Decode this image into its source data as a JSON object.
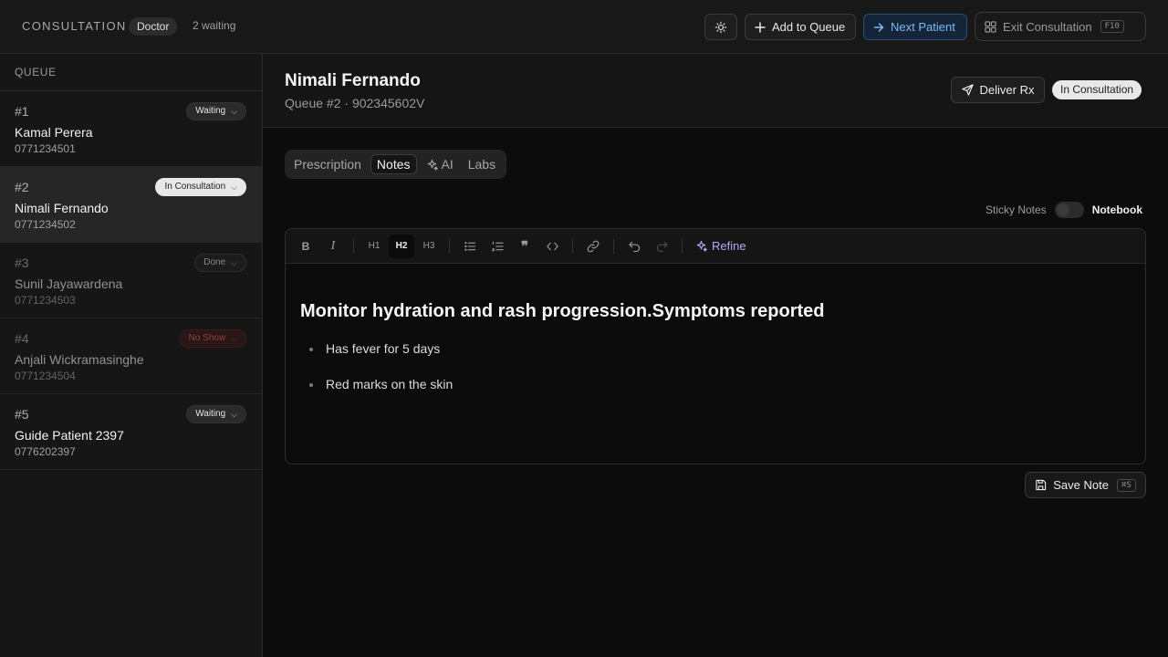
{
  "header": {
    "brand": "CONSULTATION",
    "role": "Doctor",
    "waiting": "2 waiting",
    "add_to_queue": "Add to Queue",
    "next_patient": "Next Patient",
    "exit_consultation": "Exit Consultation",
    "exit_shortcut": "F10"
  },
  "queue": {
    "title": "QUEUE",
    "items": [
      {
        "number": "#1",
        "name": "Kamal Perera",
        "phone": "0771234501",
        "status": "Waiting"
      },
      {
        "number": "#2",
        "name": "Nimali Fernando",
        "phone": "0771234502",
        "status": "In Consultation"
      },
      {
        "number": "#3",
        "name": "Sunil Jayawardena",
        "phone": "0771234503",
        "status": "Done"
      },
      {
        "number": "#4",
        "name": "Anjali Wickramasinghe",
        "phone": "0771234504",
        "status": "No Show"
      },
      {
        "number": "#5",
        "name": "Guide Patient 2397",
        "phone": "0776202397",
        "status": "Waiting"
      }
    ]
  },
  "patient": {
    "name": "Nimali Fernando",
    "meta": "Queue #2 · 902345602V",
    "deliver_rx": "Deliver Rx",
    "status": "In Consultation"
  },
  "tabs": [
    "Prescription",
    "Notes",
    "AI",
    "Labs"
  ],
  "active_tab": "Notes",
  "notes_mode": {
    "left": "Sticky Notes",
    "right": "Notebook",
    "selected": "Notebook"
  },
  "editor": {
    "toolbar": {
      "h1": "H1",
      "h2": "H2",
      "h3": "H3",
      "refine": "Refine"
    },
    "heading": "Monitor hydration and rash progression.Symptoms reported",
    "bullets": [
      "Has fever for 5 days",
      "Red marks on the skin"
    ]
  },
  "save": {
    "label": "Save Note",
    "shortcut": "⌘S"
  },
  "colors": {
    "accent_blue": "#7fb8ef",
    "refine_purple": "#b8a6f5",
    "no_show_red": "#8a4848"
  }
}
